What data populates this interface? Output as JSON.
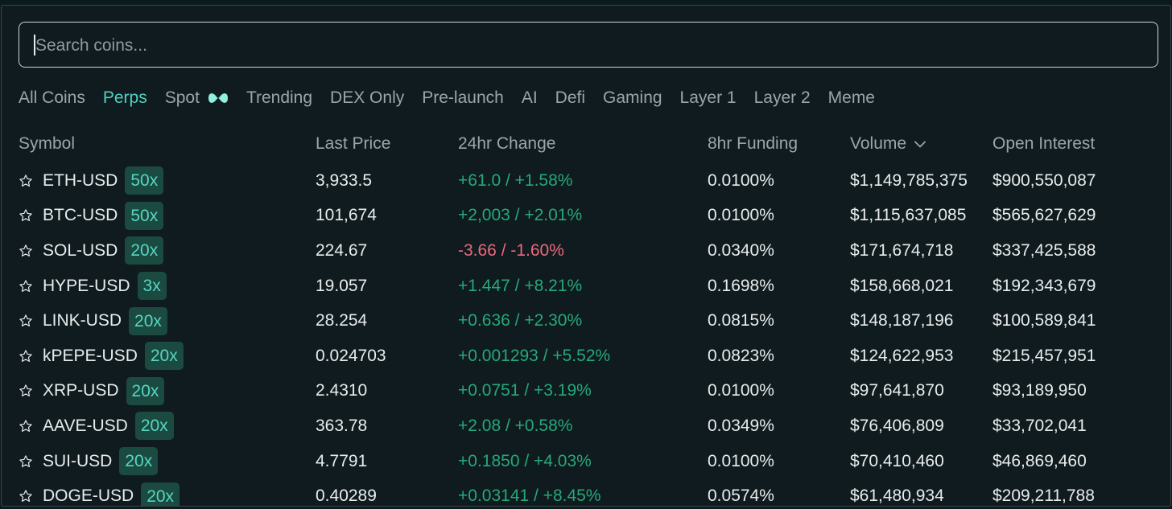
{
  "search": {
    "placeholder": "Search coins..."
  },
  "tabs": [
    {
      "label": "All Coins",
      "active": false
    },
    {
      "label": "Perps",
      "active": true
    },
    {
      "label": "Spot",
      "active": false
    },
    {
      "label": "Trending",
      "active": false
    },
    {
      "label": "DEX Only",
      "active": false
    },
    {
      "label": "Pre-launch",
      "active": false
    },
    {
      "label": "AI",
      "active": false
    },
    {
      "label": "Defi",
      "active": false
    },
    {
      "label": "Gaming",
      "active": false
    },
    {
      "label": "Layer 1",
      "active": false
    },
    {
      "label": "Layer 2",
      "active": false
    },
    {
      "label": "Meme",
      "active": false
    }
  ],
  "table": {
    "headers": {
      "symbol": "Symbol",
      "last_price": "Last Price",
      "change_24h": "24hr Change",
      "funding_8h": "8hr Funding",
      "volume": "Volume",
      "open_interest": "Open Interest"
    },
    "sort_icon": "chevron-down-icon",
    "rows": [
      {
        "symbol": "ETH-USD",
        "leverage": "50x",
        "price": "3,933.5",
        "change": "+61.0 / +1.58%",
        "trend": "pos",
        "funding": "0.0100%",
        "volume": "$1,149,785,375",
        "oi": "$900,550,087"
      },
      {
        "symbol": "BTC-USD",
        "leverage": "50x",
        "price": "101,674",
        "change": "+2,003 / +2.01%",
        "trend": "pos",
        "funding": "0.0100%",
        "volume": "$1,115,637,085",
        "oi": "$565,627,629"
      },
      {
        "symbol": "SOL-USD",
        "leverage": "20x",
        "price": "224.67",
        "change": "-3.66 / -1.60%",
        "trend": "neg",
        "funding": "0.0340%",
        "volume": "$171,674,718",
        "oi": "$337,425,588"
      },
      {
        "symbol": "HYPE-USD",
        "leverage": "3x",
        "price": "19.057",
        "change": "+1.447 / +8.21%",
        "trend": "pos",
        "funding": "0.1698%",
        "volume": "$158,668,021",
        "oi": "$192,343,679"
      },
      {
        "symbol": "LINK-USD",
        "leverage": "20x",
        "price": "28.254",
        "change": "+0.636 / +2.30%",
        "trend": "pos",
        "funding": "0.0815%",
        "volume": "$148,187,196",
        "oi": "$100,589,841"
      },
      {
        "symbol": "kPEPE-USD",
        "leverage": "20x",
        "price": "0.024703",
        "change": "+0.001293 / +5.52%",
        "trend": "pos",
        "funding": "0.0823%",
        "volume": "$124,622,953",
        "oi": "$215,457,951"
      },
      {
        "symbol": "XRP-USD",
        "leverage": "20x",
        "price": "2.4310",
        "change": "+0.0751 / +3.19%",
        "trend": "pos",
        "funding": "0.0100%",
        "volume": "$97,641,870",
        "oi": "$93,189,950"
      },
      {
        "symbol": "AAVE-USD",
        "leverage": "20x",
        "price": "363.78",
        "change": "+2.08 / +0.58%",
        "trend": "pos",
        "funding": "0.0349%",
        "volume": "$76,406,809",
        "oi": "$33,702,041"
      },
      {
        "symbol": "SUI-USD",
        "leverage": "20x",
        "price": "4.7791",
        "change": "+0.1850 / +4.03%",
        "trend": "pos",
        "funding": "0.0100%",
        "volume": "$70,410,460",
        "oi": "$46,869,460"
      },
      {
        "symbol": "DOGE-USD",
        "leverage": "20x",
        "price": "0.40289",
        "change": "+0.03141 / +8.45%",
        "trend": "pos",
        "funding": "0.0574%",
        "volume": "$61,480,934",
        "oi": "$209,211,788"
      }
    ]
  },
  "colors": {
    "background": "#0f1b1f",
    "accent": "#50d2c1",
    "positive": "#26a879",
    "negative": "#e86a7c",
    "leverage_badge_bg": "#1b4a41"
  }
}
